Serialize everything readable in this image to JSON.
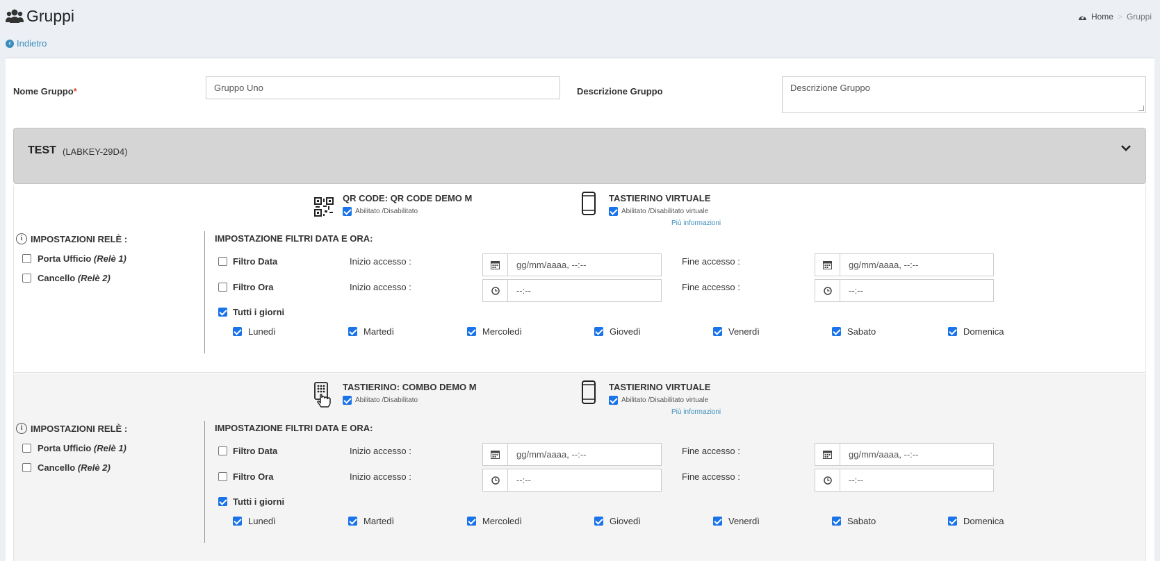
{
  "header": {
    "title": "Gruppi"
  },
  "breadcrumb": {
    "home": "Home",
    "current": "Gruppi",
    "separator": ">"
  },
  "back_link": "Indietro",
  "form": {
    "name_label": "Nome Gruppo",
    "required_mark": "*",
    "name_value": "Gruppo Uno",
    "desc_label": "Descrizione Gruppo",
    "desc_placeholder": "Descrizione Gruppo"
  },
  "device": {
    "name": "TEST",
    "code": "(LABKEY-29D4)"
  },
  "sections": [
    {
      "access": {
        "title": "QR CODE: QR CODE DEMO M",
        "toggle_label": "Abilitato /Disabilitato",
        "enabled": true,
        "icon": "qr-code-icon"
      },
      "virtual": {
        "title": "TASTIERINO VIRTUALE",
        "toggle_label": "Abilitato /Disabilitato virtuale",
        "enabled": true,
        "more": "Più informazioni",
        "icon": "smartphone-icon"
      },
      "relay_header": "IMPOSTAZIONI RELÈ :",
      "relays": [
        {
          "name": "Porta Ufficio",
          "relay": "(Relè 1)",
          "checked": false
        },
        {
          "name": "Cancello",
          "relay": "(Relè 2)",
          "checked": false
        }
      ],
      "filters_header": "IMPOSTAZIONE FILTRI DATA E ORA:",
      "filter_date": {
        "label": "Filtro Data",
        "checked": false,
        "start_label": "Inizio accesso :",
        "end_label": "Fine accesso :",
        "start_placeholder": "gg/mm/aaaa, --:--",
        "end_placeholder": "gg/mm/aaaa, --:--"
      },
      "filter_time": {
        "label": "Filtro Ora",
        "checked": false,
        "start_label": "Inizio accesso :",
        "end_label": "Fine accesso :",
        "start_placeholder": "--:--",
        "end_placeholder": "--:--"
      },
      "all_days": {
        "label": "Tutti i giorni",
        "checked": true
      },
      "days": [
        "Lunedì",
        "Martedì",
        "Mercoledì",
        "Giovedì",
        "Venerdì",
        "Sabato",
        "Domenica"
      ]
    },
    {
      "access": {
        "title": "TASTIERINO: COMBO DEMO M",
        "toggle_label": "Abilitato /Disabilitato",
        "enabled": true,
        "icon": "keypad-touch-icon"
      },
      "virtual": {
        "title": "TASTIERINO VIRTUALE",
        "toggle_label": "Abilitato /Disabilitato virtuale",
        "enabled": true,
        "more": "Più informazioni",
        "icon": "smartphone-icon"
      },
      "relay_header": "IMPOSTAZIONI RELÈ :",
      "relays": [
        {
          "name": "Porta Ufficio",
          "relay": "(Relè 1)",
          "checked": false
        },
        {
          "name": "Cancello",
          "relay": "(Relè 2)",
          "checked": false
        }
      ],
      "filters_header": "IMPOSTAZIONE FILTRI DATA E ORA:",
      "filter_date": {
        "label": "Filtro Data",
        "checked": false,
        "start_label": "Inizio accesso :",
        "end_label": "Fine accesso :",
        "start_placeholder": "gg/mm/aaaa, --:--",
        "end_placeholder": "gg/mm/aaaa, --:--"
      },
      "filter_time": {
        "label": "Filtro Ora",
        "checked": false,
        "start_label": "Inizio accesso :",
        "end_label": "Fine accesso :",
        "start_placeholder": "--:--",
        "end_placeholder": "--:--"
      },
      "all_days": {
        "label": "Tutti i giorni",
        "checked": true
      },
      "days": [
        "Lunedì",
        "Martedì",
        "Mercoledì",
        "Giovedì",
        "Venerdì",
        "Sabato",
        "Domenica"
      ]
    }
  ],
  "colors": {
    "accent": "#3c8dbc",
    "checkbox": "#1a73e8",
    "required": "#dd4b39"
  }
}
